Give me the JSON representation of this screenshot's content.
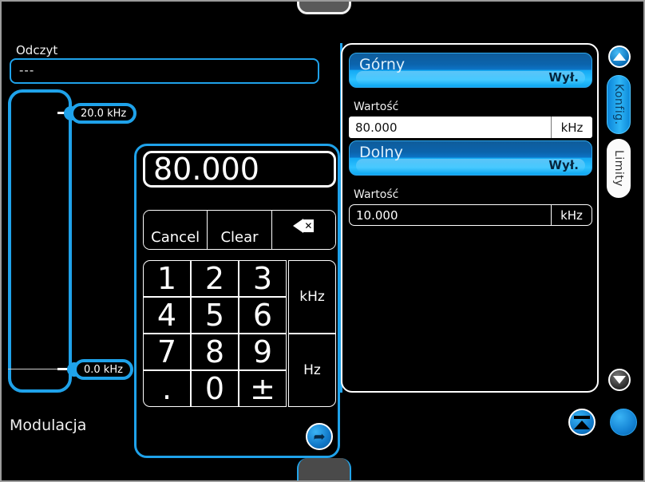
{
  "readout": {
    "label": "Odczyt",
    "value": "---"
  },
  "slider": {
    "top_label": "20.0 kHz",
    "bottom_label": "0.0 kHz",
    "caption": "Modulacja"
  },
  "keypad": {
    "display_value": "80.000",
    "cancel_label": "Cancel",
    "clear_label": "Clear",
    "backspace_icon": "backspace-icon",
    "keys": [
      "1",
      "2",
      "3",
      "4",
      "5",
      "6",
      "7",
      "8",
      "9",
      ".",
      "0",
      "±"
    ],
    "unit_khz": "kHz",
    "unit_hz": "Hz",
    "enter_icon": "enter-return-icon"
  },
  "limits": {
    "upper": {
      "name": "Górny",
      "state": "Wył.",
      "value_label": "Wartość",
      "value": "80.000",
      "unit": "kHz"
    },
    "lower": {
      "name": "Dolny",
      "state": "Wył.",
      "value_label": "Wartość",
      "value": "10.000",
      "unit": "kHz"
    }
  },
  "side_tabs": {
    "konfig": "Konfig.",
    "limity": "Limity"
  },
  "icons": {
    "scroll_up": "triangle-up-icon",
    "scroll_down": "triangle-down-icon",
    "home": "home-eject-icon",
    "blank": "blank-round-icon"
  },
  "colors": {
    "accent_blue": "#1fa2ea",
    "panel_border": "#ffffff",
    "background": "#000000",
    "toggle_dark_blue": "#0b63ac",
    "toggle_light_blue": "#2ec2ff"
  }
}
